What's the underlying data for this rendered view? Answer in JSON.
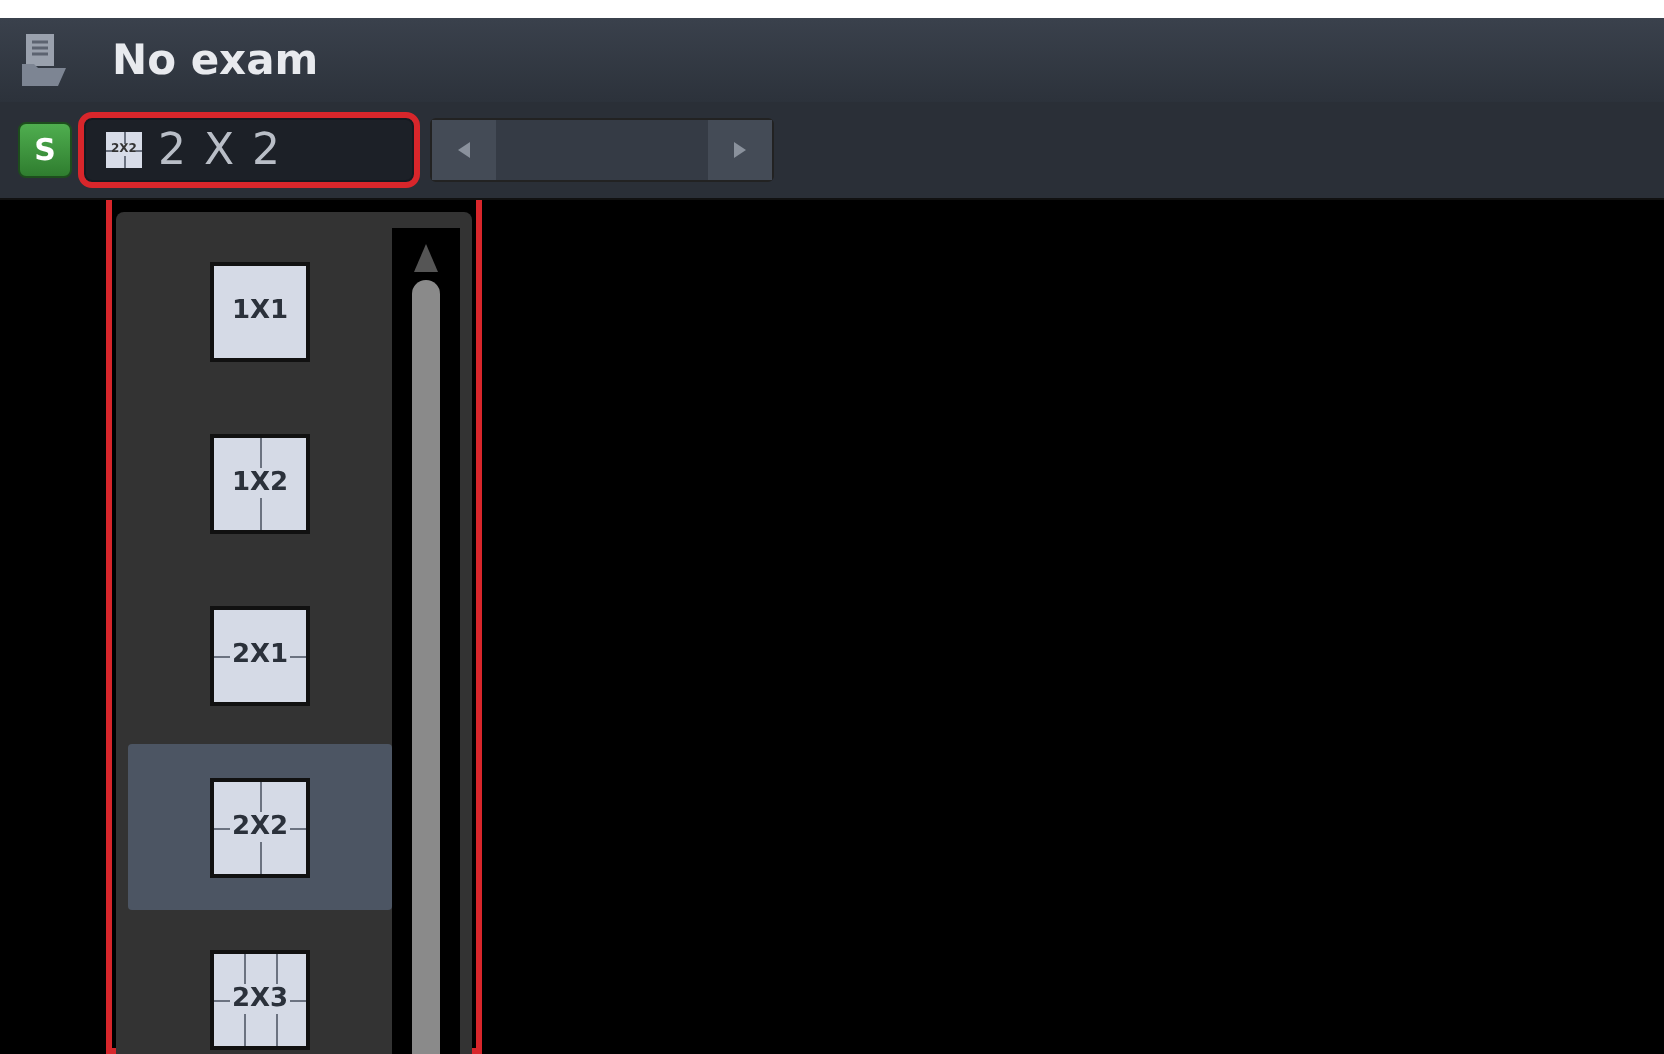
{
  "header": {
    "title": "No exam"
  },
  "toolbar": {
    "s_button": "S",
    "layout_select": {
      "icon_label": "2X2",
      "kind": "quad",
      "value": "2 X 2"
    }
  },
  "layout_menu": {
    "items": [
      {
        "label": "1X1",
        "kind": "single",
        "selected": false
      },
      {
        "label": "1X2",
        "kind": "columns",
        "selected": false
      },
      {
        "label": "2X1",
        "kind": "rows",
        "selected": false
      },
      {
        "label": "2X2",
        "kind": "quad",
        "selected": true
      },
      {
        "label": "2X3",
        "kind": "sixgrid",
        "selected": false
      }
    ]
  }
}
